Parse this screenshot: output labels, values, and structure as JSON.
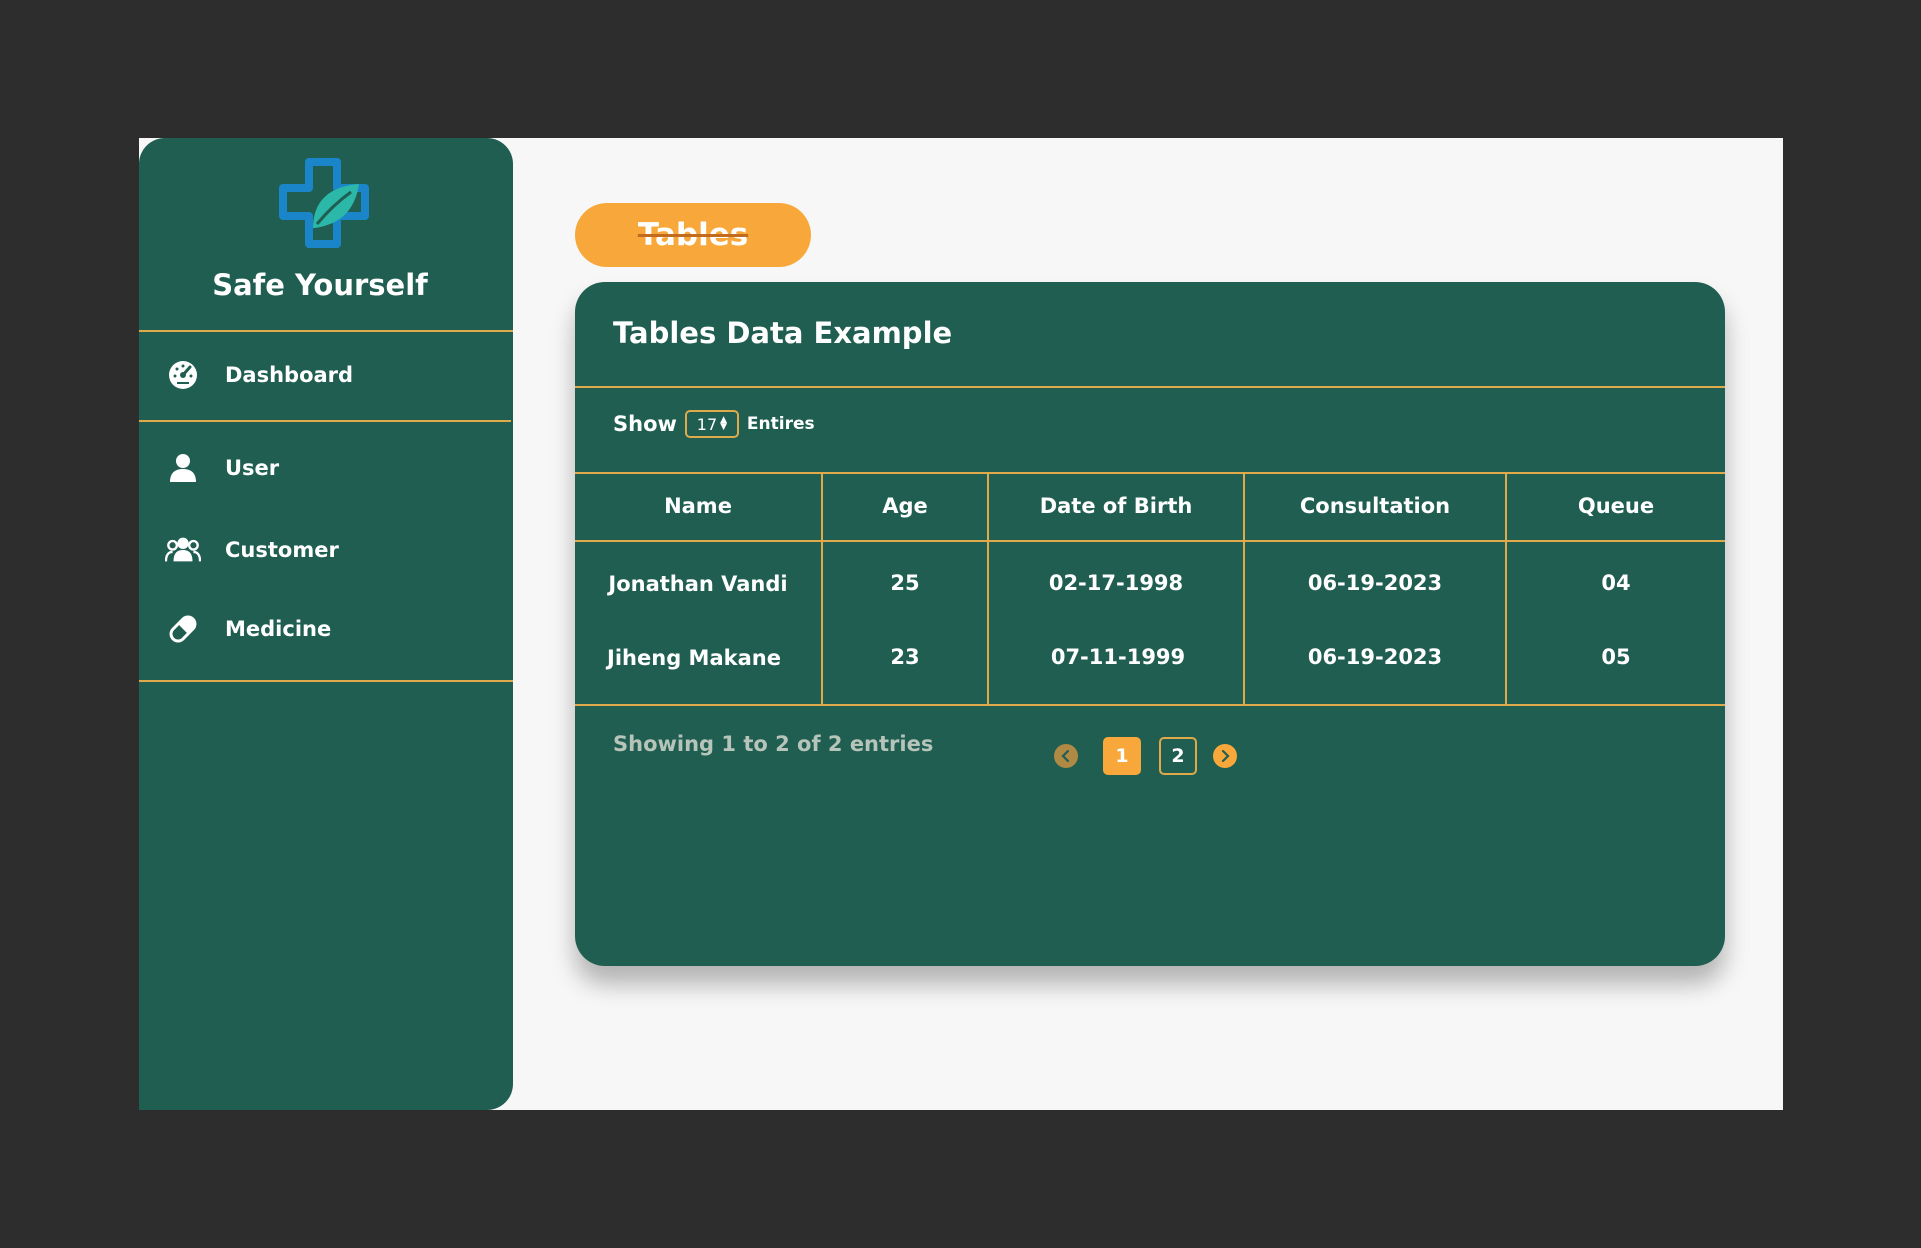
{
  "app": {
    "brand": "Safe Yourself",
    "colors": {
      "sidebar": "#1f5e51",
      "accent": "#f8a83b",
      "divider": "#e0a94a",
      "logo_blue": "#1a86c9",
      "logo_teal": "#2bb8a8"
    }
  },
  "sidebar": {
    "items": [
      {
        "label": "Dashboard",
        "icon": "speedometer-icon"
      },
      {
        "label": "User",
        "icon": "user-icon"
      },
      {
        "label": "Customer",
        "icon": "users-group-icon"
      },
      {
        "label": "Medicine",
        "icon": "pill-icon"
      }
    ]
  },
  "header": {
    "tab_label": "Tables"
  },
  "card": {
    "title": "Tables Data Example",
    "show_label": "Show",
    "entries_value": "17",
    "entries_label": "Entires",
    "columns": [
      "Name",
      "Age",
      "Date of Birth",
      "Consultation",
      "Queue"
    ],
    "rows": [
      [
        "Jonathan Vandi",
        "25",
        "02-17-1998",
        "06-19-2023",
        "04"
      ],
      [
        "Jiheng Makane",
        "23",
        "07-11-1999",
        "06-19-2023",
        "05"
      ]
    ],
    "footer_text": "Showing 1 to 2 of 2 entries",
    "pages": [
      "1",
      "2"
    ],
    "current_page": "1"
  }
}
